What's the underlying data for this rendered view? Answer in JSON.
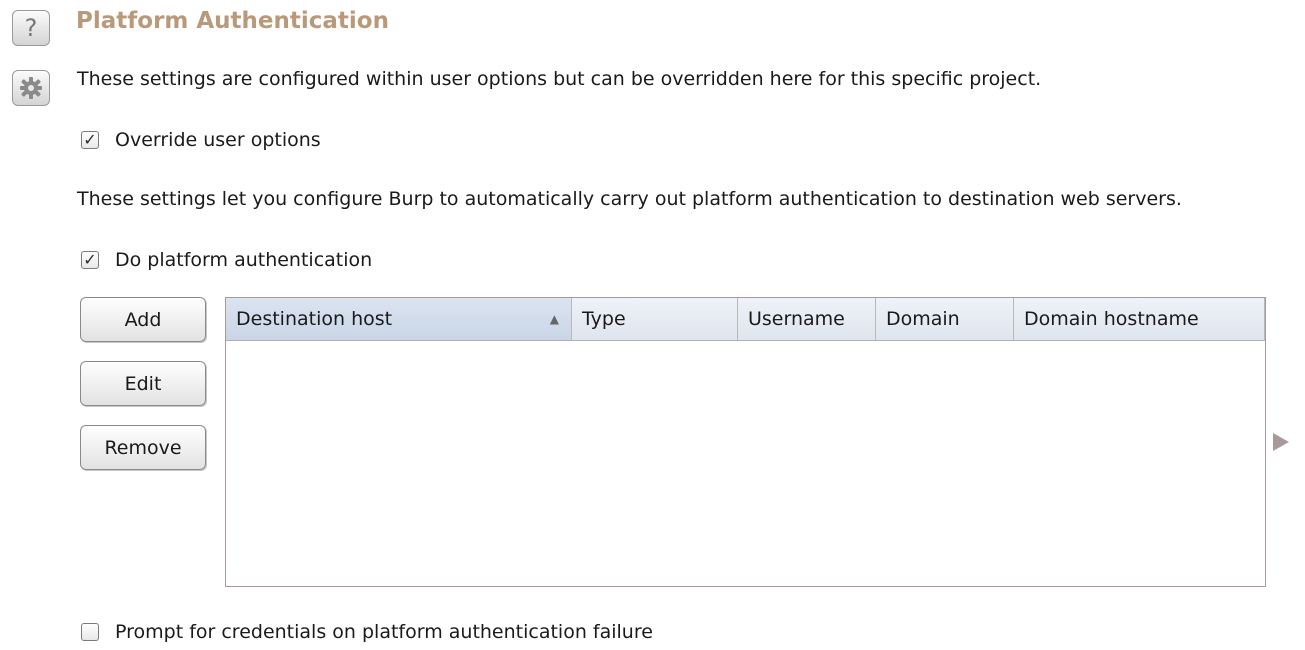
{
  "header": {
    "title": "Platform Authentication",
    "description": "These settings are configured within user options but can be overridden here for this specific project."
  },
  "icons": {
    "help": "help-icon",
    "help_glyph": "?",
    "settings": "gear-icon"
  },
  "override": {
    "label": "Override user options",
    "checked": true,
    "mark": "✓"
  },
  "info": "These settings let you configure Burp to automatically carry out platform authentication to destination web servers.",
  "do_auth": {
    "label": "Do platform authentication",
    "checked": true,
    "mark": "✓"
  },
  "buttons": {
    "add": "Add",
    "edit": "Edit",
    "remove": "Remove"
  },
  "table": {
    "columns": [
      "Destination host",
      "Type",
      "Username",
      "Domain",
      "Domain hostname"
    ],
    "sort_indicator": "▲",
    "rows": []
  },
  "prompt": {
    "label": "Prompt for credentials on platform authentication failure",
    "checked": false
  },
  "colors": {
    "title": "#b89a7a",
    "header_bg": "#dfe5ee",
    "border": "#a89a9a"
  }
}
